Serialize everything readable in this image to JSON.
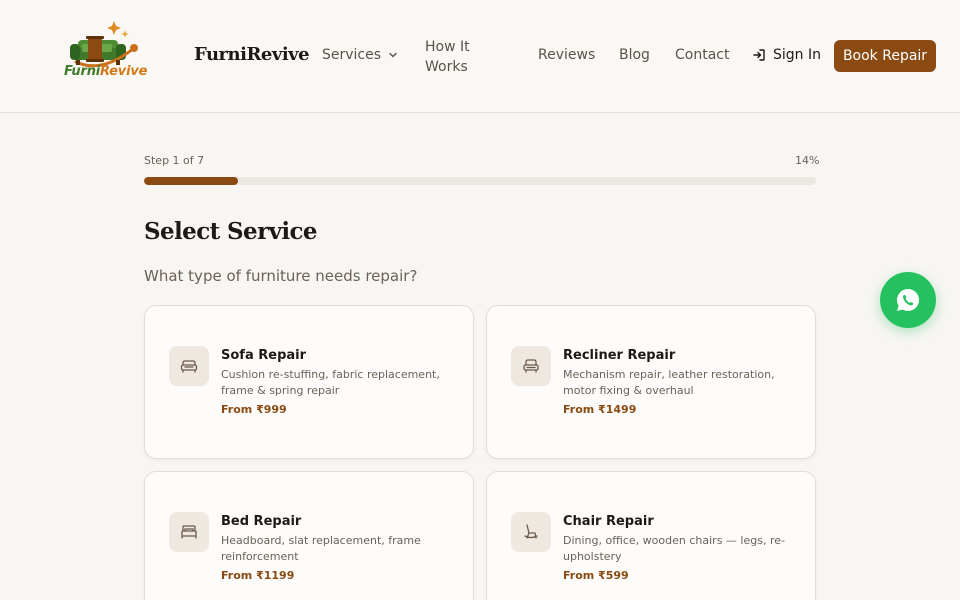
{
  "header": {
    "logo_text_1": "Furni",
    "logo_text_2": "Revive",
    "brand": "FurniRevive",
    "nav": {
      "services": "Services",
      "how_it_works": "How It Works",
      "reviews": "Reviews",
      "blog": "Blog",
      "contact": "Contact",
      "sign_in": "Sign In"
    },
    "book_button": "Book Repair"
  },
  "progress": {
    "step_label": "Step 1 of 7",
    "percent_label": "14%",
    "fraction": 0.14
  },
  "main": {
    "title": "Select Service",
    "subtitle": "What type of furniture needs repair?",
    "services": [
      {
        "icon": "sofa-icon",
        "title": "Sofa Repair",
        "description": "Cushion re-stuffing, fabric replacement, frame & spring repair",
        "price": "From ₹999"
      },
      {
        "icon": "recliner-icon",
        "title": "Recliner Repair",
        "description": "Mechanism repair, leather restoration, motor fixing & overhaul",
        "price": "From ₹1499"
      },
      {
        "icon": "bed-icon",
        "title": "Bed Repair",
        "description": "Headboard, slat replacement, frame reinforcement",
        "price": "From ₹1199"
      },
      {
        "icon": "chair-icon",
        "title": "Chair Repair",
        "description": "Dining, office, wooden chairs — legs, re-upholstery",
        "price": "From ₹599"
      }
    ]
  },
  "colors": {
    "accent": "#8a4a12",
    "whatsapp": "#25c15f",
    "background": "#f8f6f3"
  }
}
